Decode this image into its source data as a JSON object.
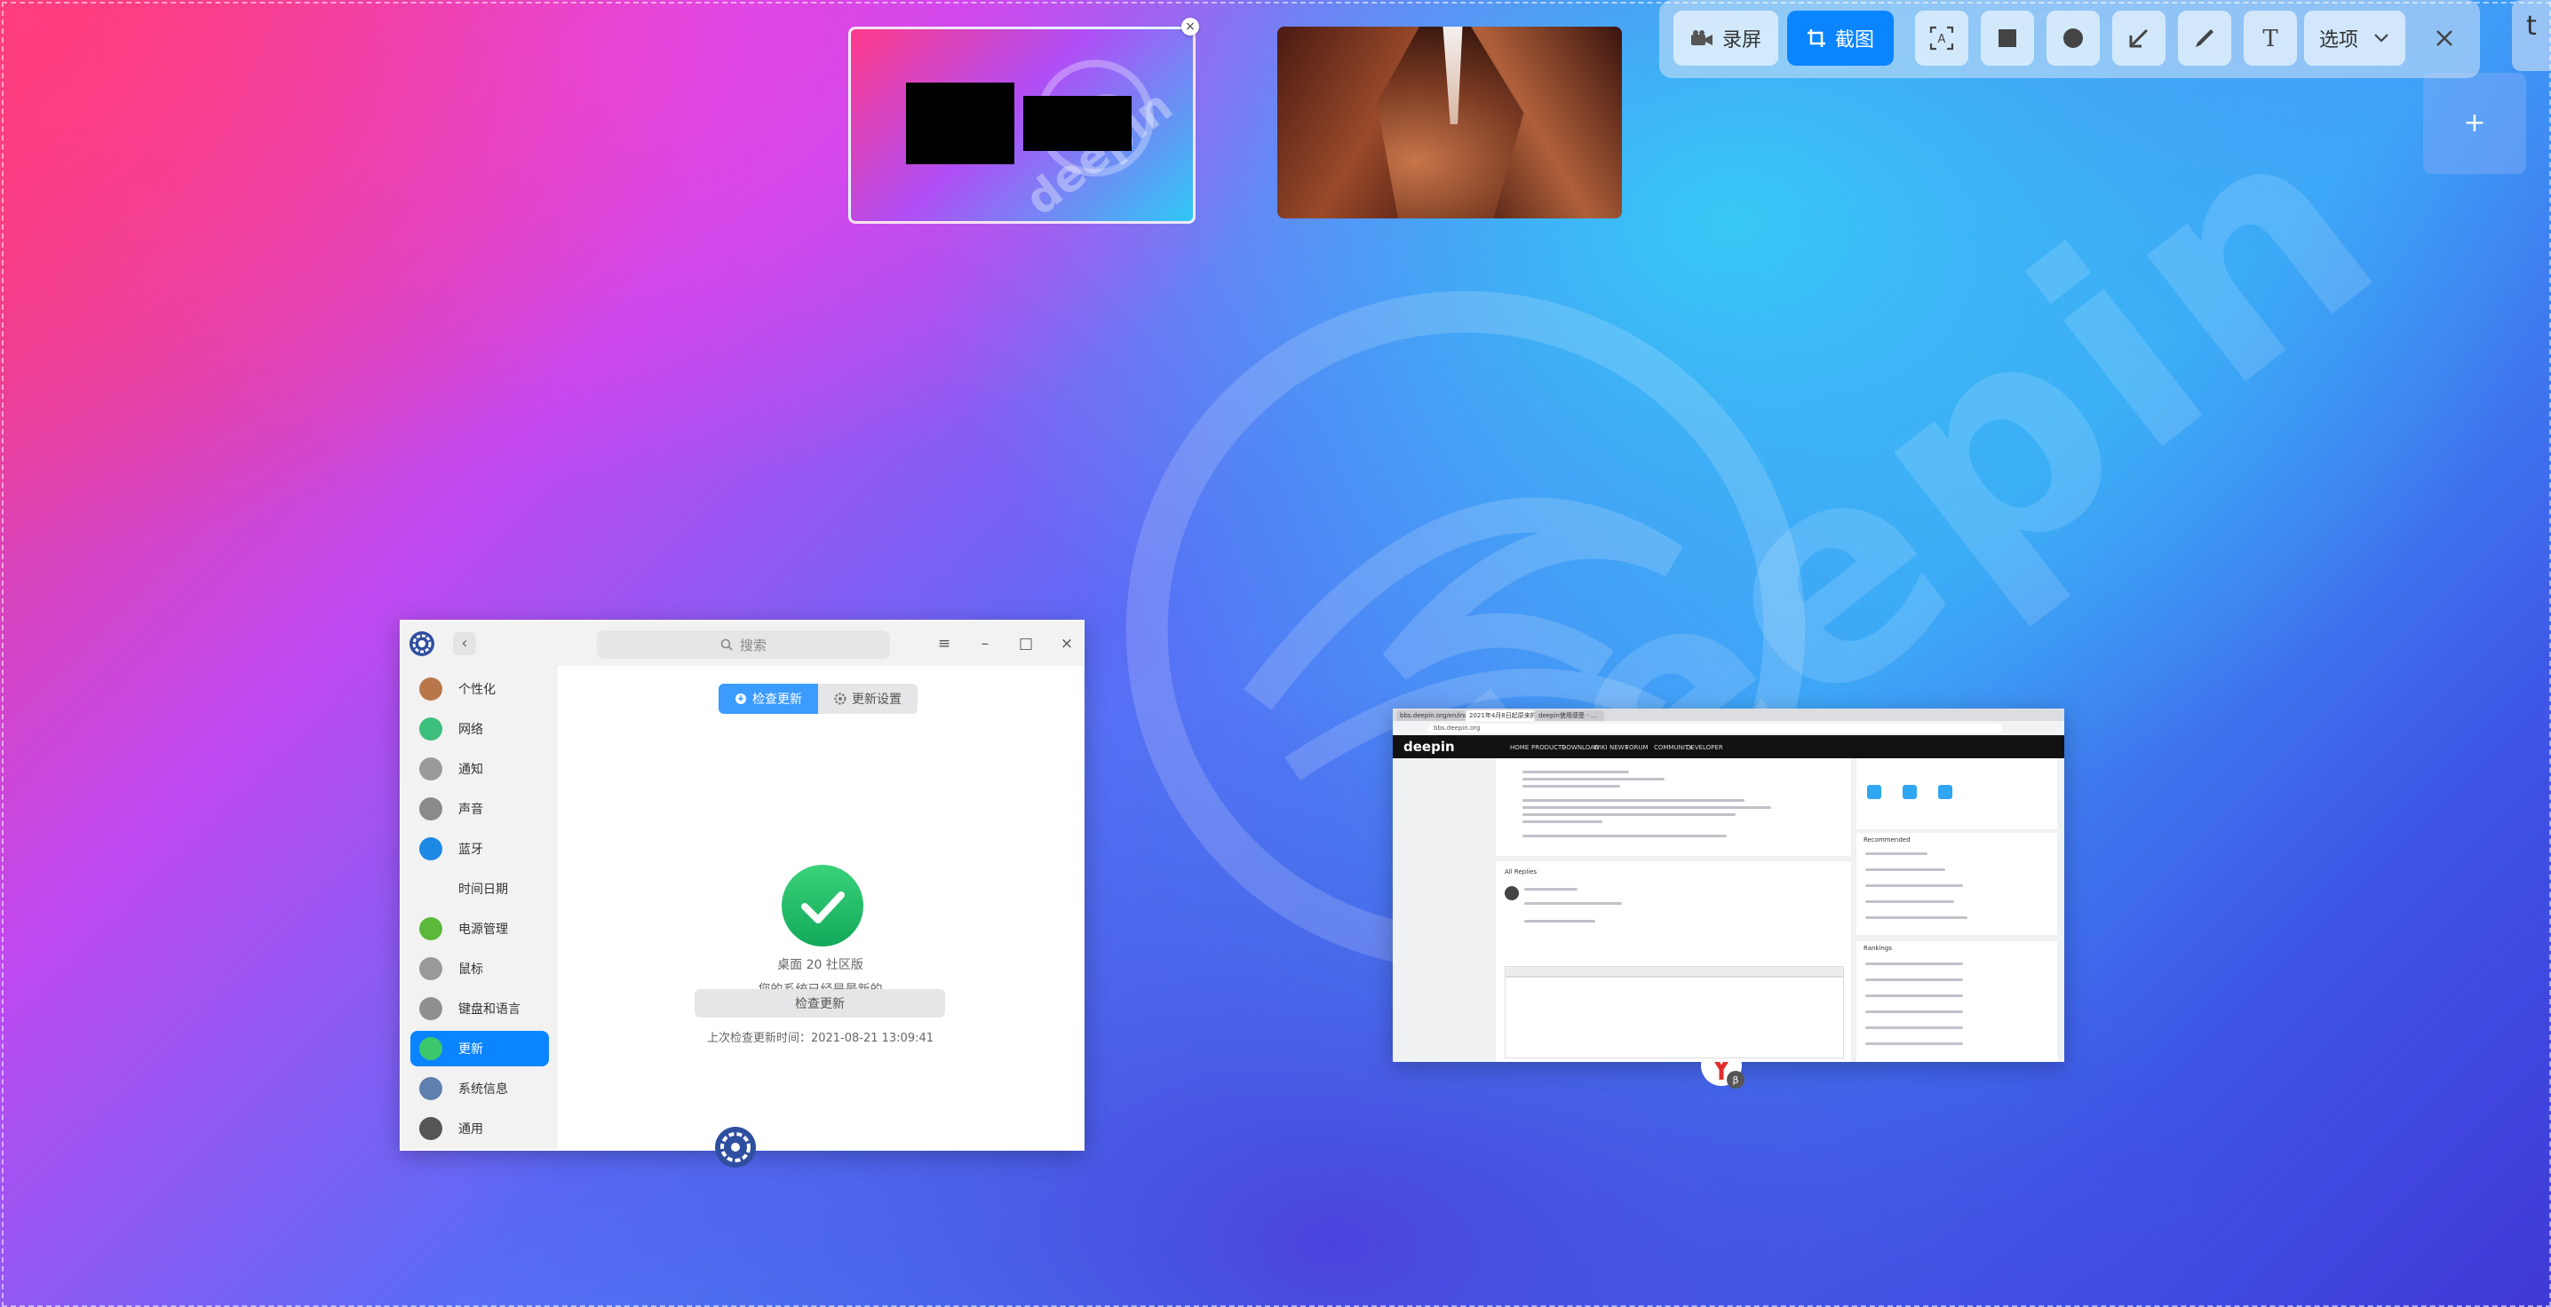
{
  "toolbar": {
    "record_label": "录屏",
    "screenshot_label": "截图",
    "options_label": "选项",
    "tools": [
      "ocr-icon",
      "rectangle-icon",
      "ellipse-icon",
      "arrow-icon",
      "pen-icon",
      "text-icon"
    ]
  },
  "right_panel": {
    "label": "t"
  },
  "workspace_add": {
    "label": "+"
  },
  "workspace_close": {
    "label": "×"
  },
  "wallpaper": {
    "word": "deepin"
  },
  "settings": {
    "search_placeholder": "搜索",
    "sidebar": [
      {
        "label": "个性化",
        "color": "#b8764a"
      },
      {
        "label": "网络",
        "color": "#3cbf7a"
      },
      {
        "label": "通知",
        "color": "#9a9a9a"
      },
      {
        "label": "声音",
        "color": "#8a8a8a"
      },
      {
        "label": "蓝牙",
        "color": "#1e88e5"
      },
      {
        "label": "时间日期",
        "color": "#f2f2f2"
      },
      {
        "label": "电源管理",
        "color": "#5cb83a"
      },
      {
        "label": "鼠标",
        "color": "#999999"
      },
      {
        "label": "键盘和语言",
        "color": "#8f8f8f"
      },
      {
        "label": "更新",
        "color": "#3cc86a"
      },
      {
        "label": "系统信息",
        "color": "#5f7fae"
      },
      {
        "label": "通用",
        "color": "#555555"
      }
    ],
    "active_index": 9,
    "tab_check": "检查更新",
    "tab_settings": "更新设置",
    "edition": "桌面 20 社区版",
    "status": "您的系统已经是最新的",
    "check_button": "检查更新",
    "last_check": "上次检查更新时间：2021-08-21 13:09:41"
  },
  "browser": {
    "tabs": [
      "bbs.deepin.org/en/index...",
      "2021年4月8日起原来的...",
      "deepin使用感受 - ..."
    ],
    "url": "bbs.deepin.org",
    "brand": "deepin",
    "menu": [
      "HOME",
      "PRODUCTS",
      "DOWNLOAD",
      "WIKI",
      "NEWS",
      "FORUM",
      "COMMUNITY",
      "DEVELOPER"
    ],
    "replies_label": "All Replies",
    "recommended_label": "Recommended",
    "rankings_label": "Rankings"
  }
}
